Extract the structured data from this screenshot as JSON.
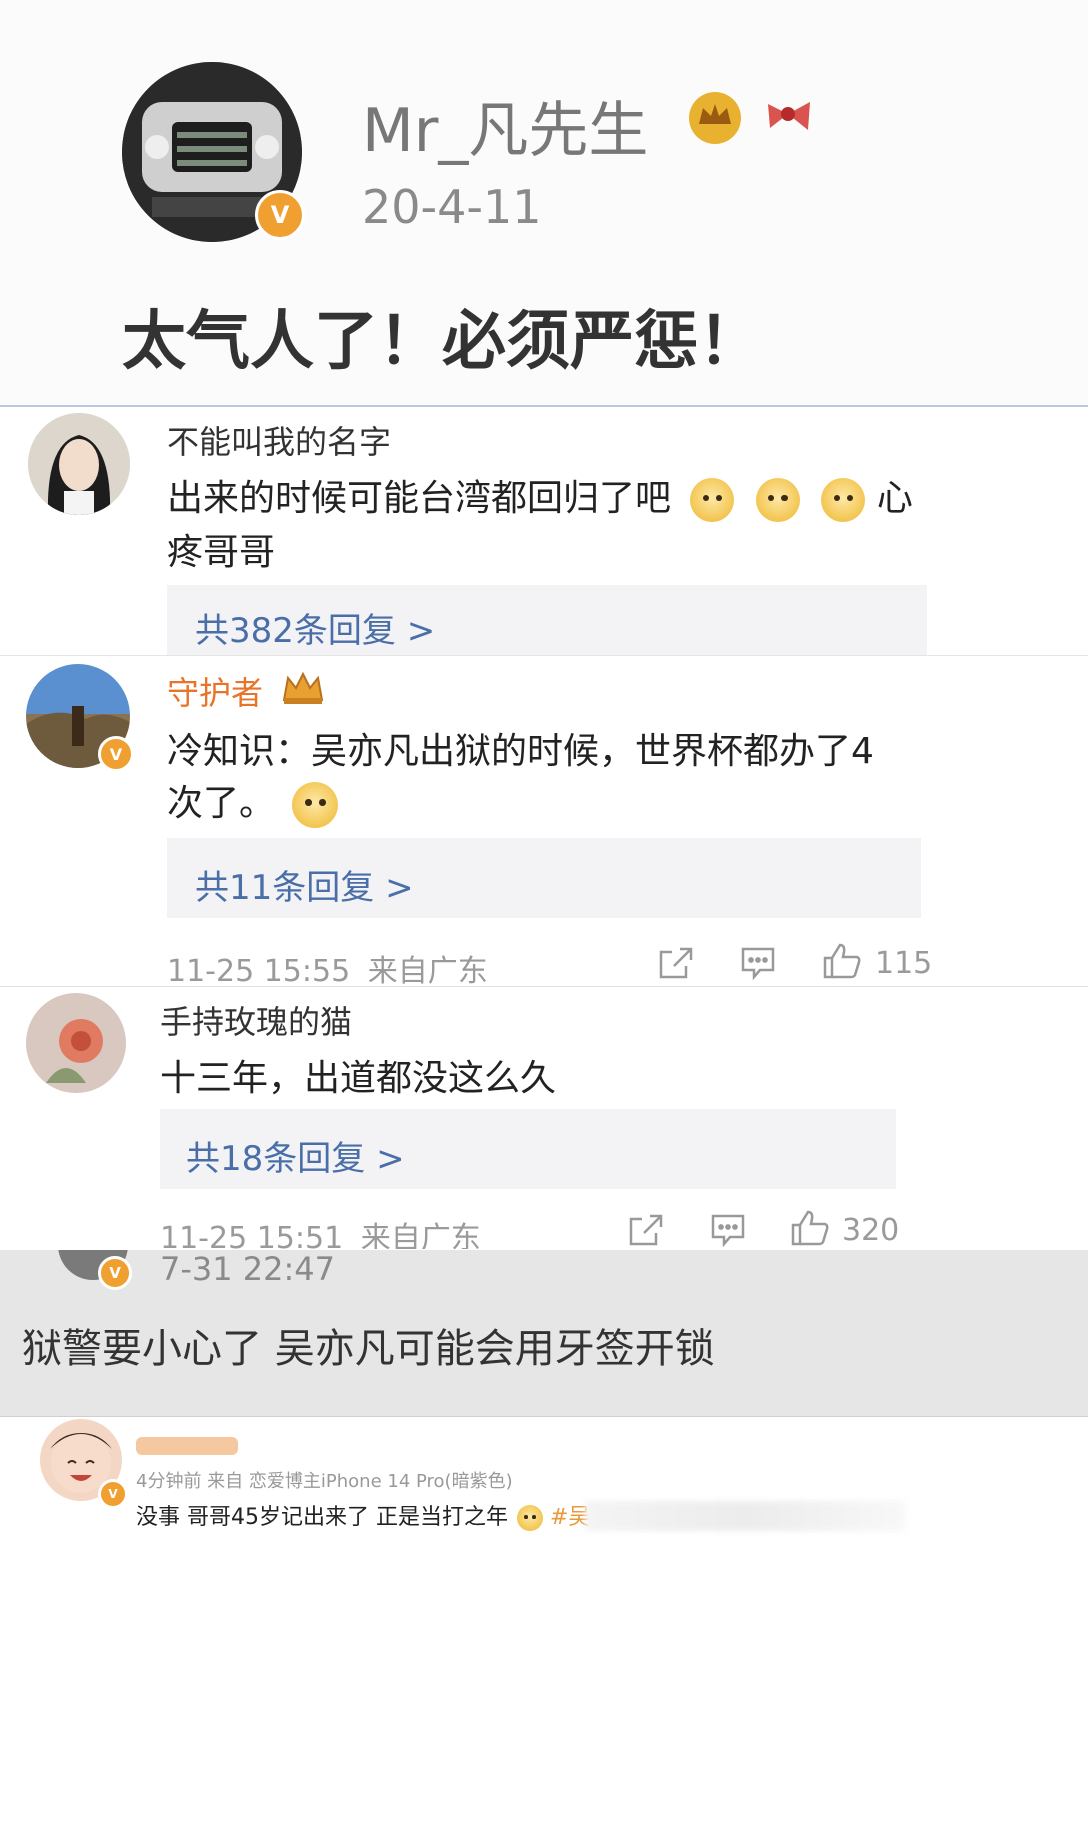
{
  "post_header": {
    "username": "Mr_凡先生",
    "date": "20-4-11",
    "text": "太气人了！必须严惩！",
    "avatar_badge": "V",
    "crown_icon": "crown-icon",
    "ribbon_icon": "ribbon-icon"
  },
  "comments": [
    {
      "username": "不能叫我的名字",
      "text_line1": "出来的时候可能台湾都回归了吧",
      "text_tail": "心",
      "text_line2": "疼哥哥",
      "replies": "共382条回复 >"
    },
    {
      "username": "守护者",
      "username_color": "#e8742a",
      "avatar_badge": "V",
      "text_line1": "冷知识：吴亦凡出狱的时候，世界杯都办了4",
      "text_line2": "次了。",
      "replies": "共11条回复 >",
      "time": "11-25 15:55",
      "location": "来自广东",
      "likes": "115"
    },
    {
      "username": "手持玫瑰的猫",
      "text_line1": "十三年，出道都没这么久",
      "replies": "共18条回复 >",
      "time": "11-25 15:51",
      "location": "来自广东",
      "likes": "320"
    }
  ],
  "screenshot_panel": {
    "date": "7-31 22:47",
    "text": "狱警要小心了 吴亦凡可能会用牙签开锁",
    "avatar_badge": "V"
  },
  "bottom_post": {
    "meta": "4分钟前  来自 恋爱博主iPhone 14 Pro(暗紫色)",
    "text": "没事 哥哥45岁记出来了 正是当打之年",
    "hashtag": "#吴"
  },
  "colors": {
    "link_blue": "#4a6ea8",
    "orange_name": "#e8742a",
    "badge_orange": "#f0a030",
    "meta_gray": "#9a9a9a"
  }
}
